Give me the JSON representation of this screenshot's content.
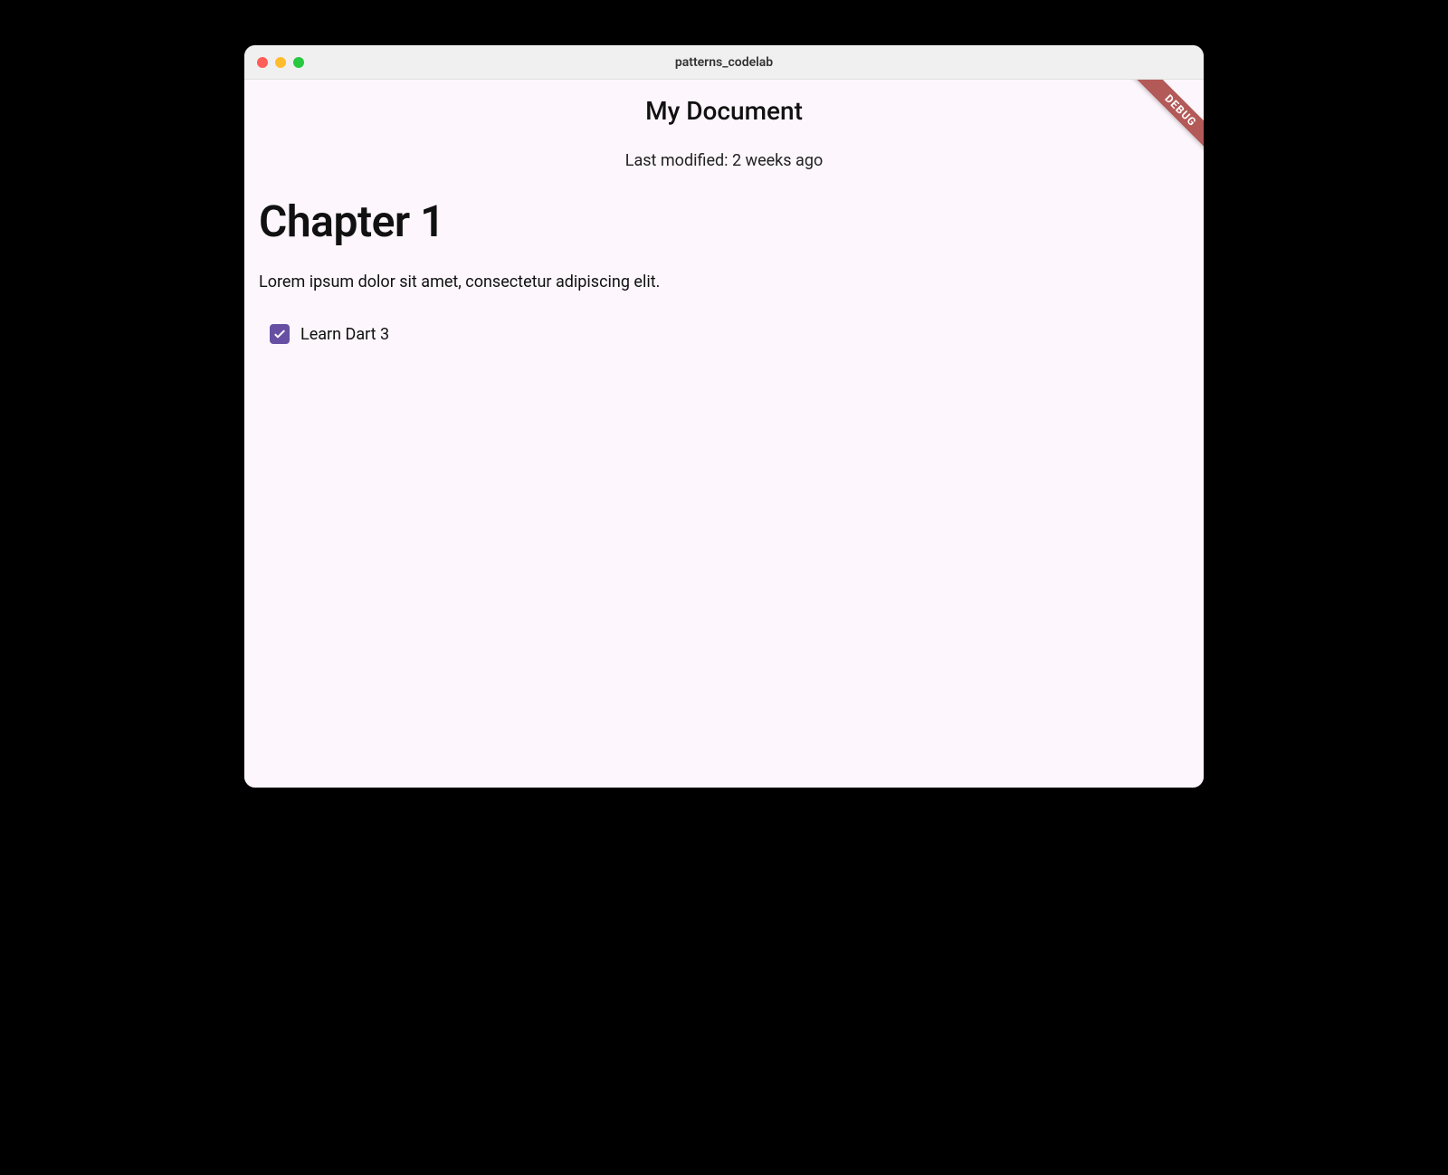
{
  "window": {
    "title": "patterns_codelab"
  },
  "debug_banner": "DEBUG",
  "header": {
    "title": "My Document",
    "subtitle": "Last modified: 2 weeks ago"
  },
  "content": {
    "heading": "Chapter 1",
    "paragraph": "Lorem ipsum dolor sit amet, consectetur adipiscing elit."
  },
  "todo": {
    "label": "Learn Dart 3",
    "checked": true
  },
  "colors": {
    "checkbox_fill": "#6750a4",
    "background": "#fdf7fd",
    "debug_banner": "#b35a58"
  }
}
